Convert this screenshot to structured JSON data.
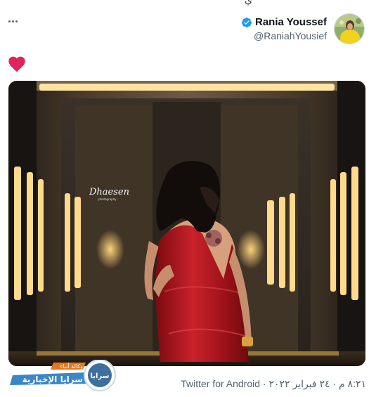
{
  "header": {
    "cropped_text": "ي"
  },
  "tweet": {
    "author_name": "Rania Youssef",
    "author_handle": "@RaniahYousief",
    "verified": true,
    "liked": true,
    "photo_watermark": "Dhaesen photography",
    "source": "Twitter for Android",
    "timestamp": "٨:٢١ م · ٢٤ فبراير ٢٠٢٢ ·"
  },
  "overlay_logo": {
    "top_text": "وكالة أنباء",
    "main_text": "سرايا الإخبارية",
    "badge_text": "سرايا"
  },
  "colors": {
    "like_red": "#e0245e",
    "verified_blue": "#1d9bf0",
    "dress_red": "#b3141d",
    "logo_orange": "#e4771f",
    "logo_blue": "#3a86c8"
  }
}
